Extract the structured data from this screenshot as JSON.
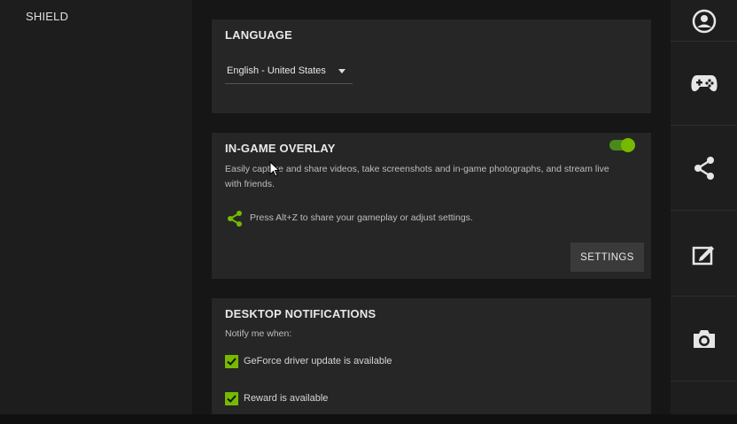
{
  "left_sidebar": {
    "item": "SHIELD"
  },
  "language": {
    "title": "LANGUAGE",
    "selected": "English - United States"
  },
  "overlay": {
    "title": "IN-GAME OVERLAY",
    "enabled": true,
    "description": "Easily capture and share videos, take screenshots and in-game photographs, and stream live with friends.",
    "hint": "Press Alt+Z to share your gameplay or adjust settings.",
    "settings_label": "SETTINGS"
  },
  "notifications": {
    "title": "DESKTOP NOTIFICATIONS",
    "subtitle": "Notify me when:",
    "items": [
      {
        "label": "GeForce driver update is available",
        "checked": true
      },
      {
        "label": "Reward is available",
        "checked": true
      }
    ]
  },
  "right_sidebar_icons": [
    "account-icon",
    "gamepad-icon",
    "share-icon",
    "edit-icon",
    "camera-icon"
  ],
  "colors": {
    "accent": "#76b900",
    "card": "#262626",
    "background": "#161616"
  }
}
